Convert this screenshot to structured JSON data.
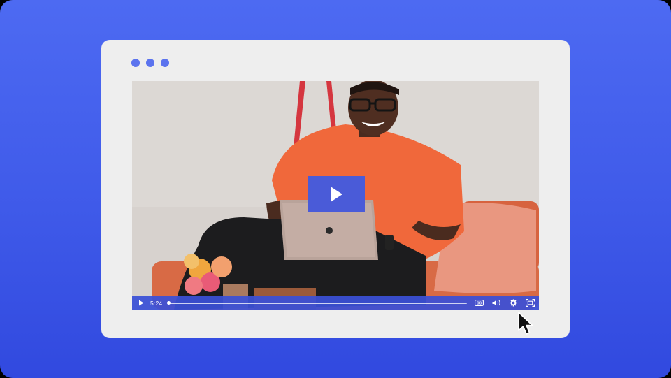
{
  "window": {
    "dots": [
      {
        "name": "window-dot-1",
        "color": "#5b73ee"
      },
      {
        "name": "window-dot-2",
        "color": "#5b73ee"
      },
      {
        "name": "window-dot-3",
        "color": "#5b73ee"
      }
    ]
  },
  "player": {
    "current_time": "5:24",
    "progress": 0.0,
    "accent_color": "#3a50d6",
    "big_play_color": "#4a5bd8",
    "icons": {
      "big_play": "play-icon",
      "play": "play-icon",
      "captions": "closed-captions-icon",
      "volume": "volume-icon",
      "settings": "gear-icon",
      "fullscreen": "fullscreen-icon"
    }
  },
  "pointer": {
    "icon": "mouse-pointer-icon"
  }
}
